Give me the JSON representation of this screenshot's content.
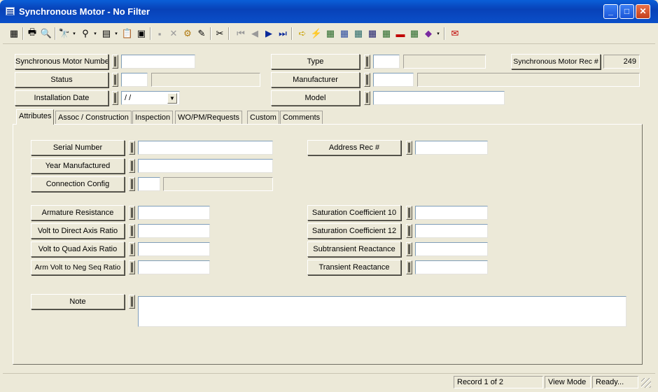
{
  "window": {
    "title": "Synchronous Motor - No Filter",
    "min": "_",
    "max": "□",
    "close": "✕"
  },
  "toolbar": {
    "icons": [
      "▦",
      "🖶",
      "🔍",
      "🔭",
      "▾",
      "⚲",
      "▾",
      "▤",
      "▾",
      "📋",
      "▣",
      "▪",
      "✕",
      "⚙",
      "✎",
      "✂",
      "⏮",
      "◀",
      "▶",
      "⏭",
      "➪",
      "⚡",
      "▦",
      "▦",
      "▦",
      "▦",
      "▦",
      "▬",
      "▦",
      "◆",
      "▾",
      "✉"
    ]
  },
  "header": {
    "motor_number": {
      "label": "Synchronous Motor Number",
      "value": ""
    },
    "status": {
      "label": "Status",
      "code": "",
      "desc": ""
    },
    "install_date": {
      "label": "Installation Date",
      "value": "/ /"
    },
    "type": {
      "label": "Type",
      "code": "",
      "desc": ""
    },
    "manufacturer": {
      "label": "Manufacturer",
      "code": "",
      "desc": ""
    },
    "model": {
      "label": "Model",
      "value": ""
    },
    "rec": {
      "label": "Synchronous Motor Rec #",
      "value": "249"
    }
  },
  "tabs": [
    "Attributes",
    "Assoc / Construction",
    "Inspection",
    "WO/PM/Requests",
    "Custom",
    "Comments"
  ],
  "attributes": {
    "serial_number": "Serial Number",
    "year_manufactured": "Year Manufactured",
    "connection_config": "Connection Config",
    "address_rec": "Address Rec #",
    "armature_resistance": "Armature Resistance",
    "volt_direct": "Volt to Direct Axis Ratio",
    "volt_quad": "Volt to Quad Axis Ratio",
    "arm_volt_neg": "Arm Volt to Neg Seq Ratio",
    "sat_coef_10": "Saturation Coefficient 10",
    "sat_coef_12": "Saturation Coefficient 12",
    "subtransient": "Subtransient Reactance",
    "transient": "Transient Reactance",
    "note": "Note"
  },
  "status": {
    "record": "Record 1 of 2",
    "mode": "View Mode",
    "state": "Ready..."
  }
}
